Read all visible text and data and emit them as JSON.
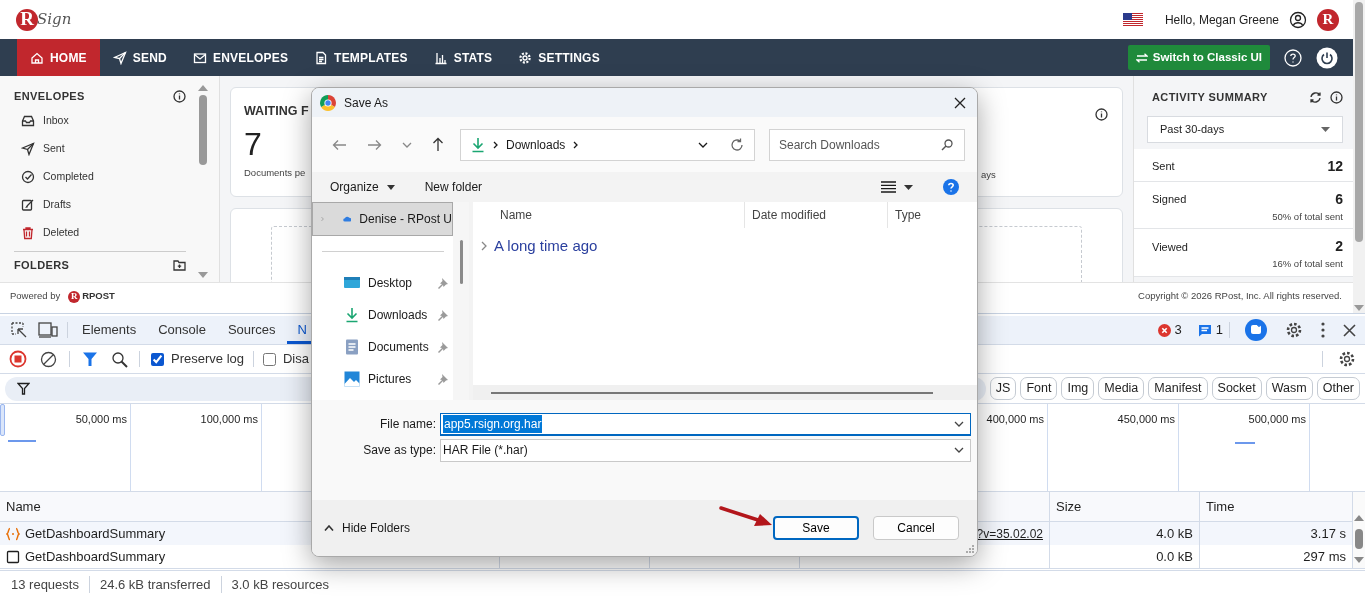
{
  "header": {
    "logo_mark": "R",
    "logo_word": "Sign",
    "greeting": "Hello, Megan Greene",
    "avatar": "R"
  },
  "nav": {
    "items": [
      {
        "label": "HOME",
        "selected": true
      },
      {
        "label": "SEND",
        "selected": false
      },
      {
        "label": "ENVELOPES",
        "selected": false
      },
      {
        "label": "TEMPLATES",
        "selected": false
      },
      {
        "label": "STATS",
        "selected": false
      },
      {
        "label": "SETTINGS",
        "selected": false
      }
    ],
    "classic_button": "Switch to Classic UI"
  },
  "sidebar": {
    "title": "ENVELOPES",
    "items": [
      {
        "label": "Inbox"
      },
      {
        "label": "Sent"
      },
      {
        "label": "Completed"
      },
      {
        "label": "Drafts"
      },
      {
        "label": "Deleted"
      }
    ],
    "folders_title": "FOLDERS"
  },
  "cards": [
    {
      "title": "WAITING F",
      "count": "7",
      "caption": "Documents pe"
    },
    {
      "caption": "ays"
    }
  ],
  "activity": {
    "title": "ACTIVITY SUMMARY",
    "period": "Past 30-days",
    "stats": [
      {
        "label": "Sent",
        "value": "12"
      },
      {
        "label": "Signed",
        "value": "6",
        "note": "50% of total sent"
      },
      {
        "label": "Viewed",
        "value": "2",
        "note": "16% of total sent"
      }
    ]
  },
  "footer": {
    "powered_by": "Powered by",
    "brand_mark": "R",
    "brand": "RPOST",
    "copyright": "Copyright © 2026 RPost, Inc. All rights reserved."
  },
  "devtools": {
    "tabs": [
      {
        "label": "Elements",
        "selected": false
      },
      {
        "label": "Console",
        "selected": false
      },
      {
        "label": "Sources",
        "selected": false
      },
      {
        "label": "N",
        "selected": true
      }
    ],
    "errors": "3",
    "messages": "1",
    "preserve_log": {
      "label": "Preserve log",
      "checked": true
    },
    "disable_cache": {
      "label": "Disa",
      "checked": false
    },
    "chips": [
      "JS",
      "Font",
      "Img",
      "Media",
      "Manifest",
      "Socket",
      "Wasm",
      "Other"
    ],
    "timeline": {
      "ticks_left": [
        "50,000 ms",
        "100,000 ms"
      ],
      "ticks_right": [
        "400,000 ms",
        "450,000 ms",
        "500,000 ms"
      ]
    },
    "columns": [
      "Name",
      "Size",
      "Time"
    ],
    "rows": [
      {
        "kind": "fetch",
        "name": "GetDashboardSummary",
        "initiator": "?v=35.02.02",
        "size": "4.0 kB",
        "time": "3.17 s"
      },
      {
        "kind": "preflight",
        "name": "GetDashboardSummary",
        "size": "0.0 kB",
        "time": "297 ms"
      }
    ],
    "status": [
      "13 requests",
      "24.6 kB transferred",
      "3.0 kB resources"
    ]
  },
  "dialog": {
    "title": "Save As",
    "path": "Downloads",
    "search_placeholder": "Search Downloads",
    "organize": "Organize",
    "new_folder": "New folder",
    "nav_items": [
      {
        "kind": "drive",
        "label": "Denise - RPost U",
        "selected": true
      },
      {
        "kind": "quick",
        "label": "Desktop",
        "selected": false
      },
      {
        "kind": "quick",
        "label": "Downloads",
        "selected": false
      },
      {
        "kind": "quick",
        "label": "Documents",
        "selected": false
      },
      {
        "kind": "quick",
        "label": "Pictures",
        "selected": false
      }
    ],
    "columns": [
      "Name",
      "Date modified",
      "Type"
    ],
    "group": "A long time ago",
    "file_name_label": "File name:",
    "file_name": "app5.rsign.org.har",
    "type_label": "Save as type:",
    "save_as_type": "HAR File (*.har)",
    "hide_folders": "Hide Folders",
    "buttons": [
      "Save",
      "Cancel"
    ]
  }
}
